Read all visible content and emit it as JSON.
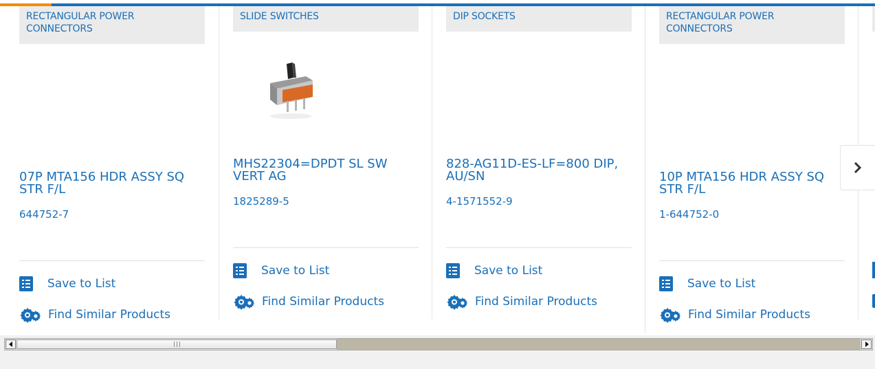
{
  "cards": [
    {
      "category": "RECTANGULAR POWER CONNECTORS",
      "title": "07P MTA156 HDR ASSY SQ STR F/L",
      "part_number": "644752-7",
      "save_label": "Save to List",
      "similar_label": "Find Similar Products"
    },
    {
      "category": "SLIDE SWITCHES",
      "title": "MHS22304=DPDT SL SW VERT AG",
      "part_number": "1825289-5",
      "save_label": "Save to List",
      "similar_label": "Find Similar Products"
    },
    {
      "category": "DIP SOCKETS",
      "title": "828-AG11D-ES-LF=800 DIP, AU/SN",
      "part_number": "4-1571552-9",
      "save_label": "Save to List",
      "similar_label": "Find Similar Products"
    },
    {
      "category": "RECTANGULAR POWER CONNECTORS",
      "title": "10P MTA156 HDR ASSY SQ STR F/L",
      "part_number": "1-644752-0",
      "save_label": "Save to List",
      "similar_label": "Find Similar Products"
    }
  ],
  "icons": {
    "save": "list-icon",
    "similar": "gear-icon",
    "next": "chevron-right-icon",
    "scroll_left": "arrow-left-icon",
    "scroll_right": "arrow-right-icon"
  },
  "colors": {
    "accent": "#1a6fb8",
    "highlight": "#f28c00",
    "category_bg": "#ebebeb"
  }
}
